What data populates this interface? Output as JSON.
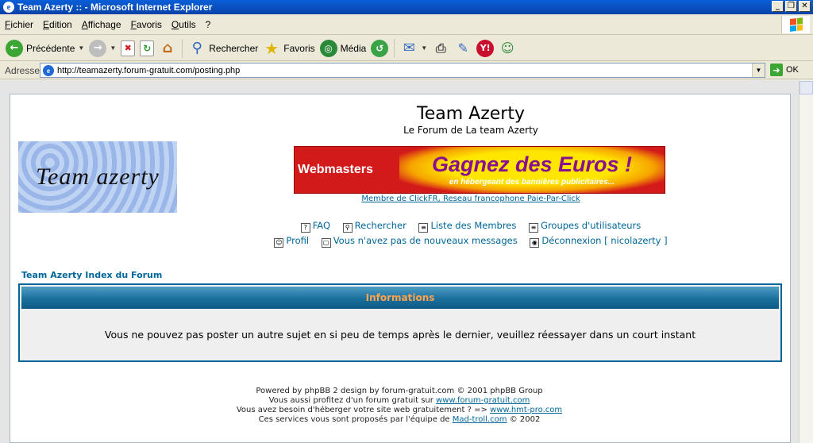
{
  "window": {
    "title": "Team Azerty :: - Microsoft Internet Explorer"
  },
  "menubar": {
    "items": [
      "Fichier",
      "Edition",
      "Affichage",
      "Favoris",
      "Outils",
      "?"
    ]
  },
  "toolbar": {
    "back": "Précédente",
    "search": "Rechercher",
    "favorites": "Favoris",
    "media": "Média"
  },
  "address": {
    "label": "Adresse",
    "url": "http://teamazerty.forum-gratuit.com/posting.php",
    "go": "OK"
  },
  "site": {
    "title": "Team Azerty",
    "subtitle": "Le Forum de La team Azerty",
    "logo_text": "Team azerty"
  },
  "banner": {
    "left": "Webmasters",
    "main": "Gagnez des Euros !",
    "small": "en hébergeant des bannières publicitaires...",
    "link": "Membre de ClickFR, Reseau francophone Paie-Par-Click"
  },
  "nav": {
    "faq": "FAQ",
    "search": "Rechercher",
    "members": "Liste des Membres",
    "groups": "Groupes d'utilisateurs",
    "profile": "Profil",
    "messages": "Vous n'avez pas de nouveaux messages",
    "logout": "Déconnexion [ nicolazerty ]"
  },
  "breadcrumb": "Team Azerty Index du Forum",
  "info": {
    "header": "Informations",
    "message": "Vous ne pouvez pas poster un autre sujet en si peu de temps après le dernier, veuillez réessayer dans un court instant"
  },
  "footer": {
    "line1": "Powered by phpBB 2 design by forum-gratuit.com © 2001 phpBB Group",
    "line2_pre": "Vous aussi profitez d'un forum gratuit sur ",
    "line2_link": "www.forum-gratuit.com",
    "line3_pre": "Vous avez besoin d'héberger votre site web gratuitement ? => ",
    "line3_link": "www.hmt-pro.com",
    "line4_pre": "Ces services vous sont proposés par l'équipe de ",
    "line4_link": "Mad-troll.com",
    "line4_post": " © 2002"
  },
  "colors": {
    "link": "#006699",
    "header_text": "#ffa34f",
    "banner_red": "#d31a1a"
  }
}
